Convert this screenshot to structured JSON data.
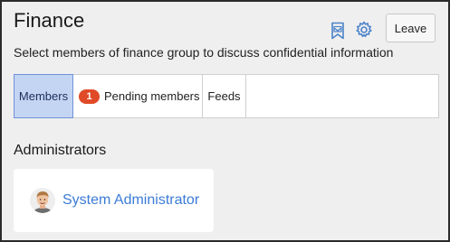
{
  "header": {
    "title": "Finance",
    "subtitle": "Select members of finance group to discuss confidential information",
    "leave_label": "Leave",
    "icons": [
      "mail-inbox-icon",
      "gear-icon"
    ]
  },
  "tabs": [
    {
      "label": "Members",
      "active": true
    },
    {
      "label": "Pending members",
      "badge": "1"
    },
    {
      "label": "Feeds"
    }
  ],
  "section": {
    "title": "Administrators",
    "members": [
      {
        "name": "System Administrator",
        "avatar_icon": "user-avatar"
      }
    ]
  },
  "colors": {
    "accent_link": "#3b7bd6",
    "badge": "#e04a27",
    "active_tab_bg": "#c4d5f3",
    "icon_blue": "#4a82c9"
  }
}
